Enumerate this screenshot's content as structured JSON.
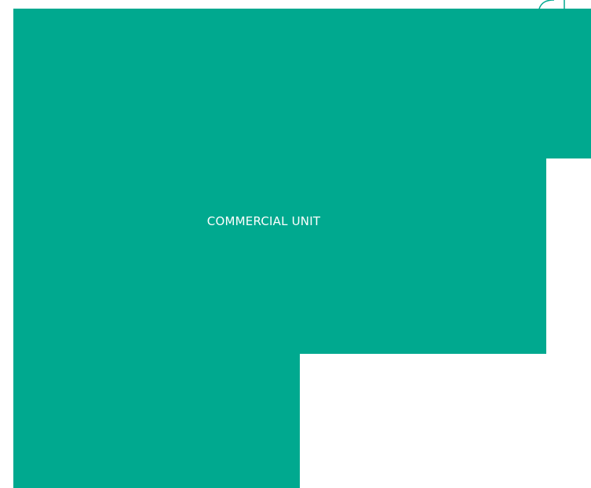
{
  "floor_plan": {
    "units": [
      {
        "label": "COMMERCIAL UNIT",
        "color": "#00A98F"
      }
    ],
    "outline_color": "#00A98F"
  }
}
